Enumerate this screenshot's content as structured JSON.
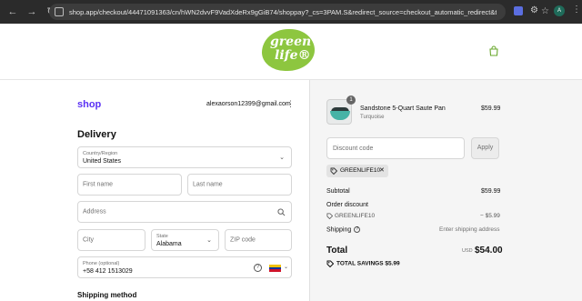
{
  "browser": {
    "url": "shop.app/checkout/44471091363/cn/hWN2dvvF9VadXdeRx9gGiB74/shoppay?_cs=3PAM.S&redirect_source=checkout_automatic_redirect&tracking_unique=4...",
    "profile_initial": "A"
  },
  "store": {
    "logo_line1": "green",
    "logo_line2": "life®",
    "brand_color": "#8dc63f"
  },
  "account": {
    "shop_label": "shop",
    "email": "alexaorson12399@gmail.com"
  },
  "delivery": {
    "title": "Delivery",
    "country_label": "Country/Region",
    "country_value": "United States",
    "first_name_placeholder": "First name",
    "last_name_placeholder": "Last name",
    "address_placeholder": "Address",
    "city_placeholder": "City",
    "state_label": "State",
    "state_value": "Alabama",
    "zip_placeholder": "ZIP code",
    "phone_label": "Phone (optional)",
    "phone_value": "+58 412 1513029",
    "shipping_method_title": "Shipping method"
  },
  "summary": {
    "product_name": "Sandstone 5-Quart Saute Pan",
    "product_variant": "Turquoise",
    "product_price": "$59.99",
    "quantity": "1",
    "discount_placeholder": "Discount code",
    "apply_label": "Apply",
    "applied_code": "GREENLIFE10",
    "subtotal_label": "Subtotal",
    "subtotal_value": "$59.99",
    "order_discount_label": "Order discount",
    "discount_code": "GREENLIFE10",
    "discount_value": "− $5.99",
    "shipping_label": "Shipping",
    "shipping_value": "Enter shipping address",
    "total_label": "Total",
    "total_currency": "USD",
    "total_value": "$54.00",
    "savings_text": "TOTAL SAVINGS  $5.99"
  }
}
